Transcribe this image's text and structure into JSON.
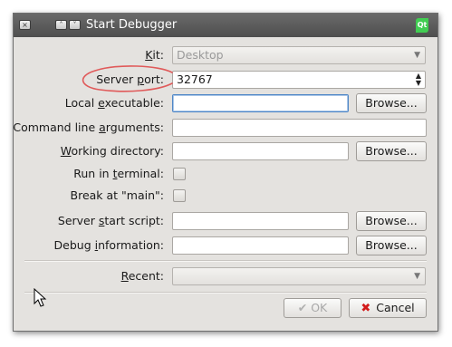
{
  "window": {
    "title": "Start Debugger",
    "close_glyph": "×",
    "minimize_glyph": "˄",
    "maximize_glyph": "˅",
    "app_icon_text": "Qt"
  },
  "form": {
    "kit": {
      "label_pre": "",
      "label_ul": "K",
      "label_post": "it:",
      "value": "Desktop"
    },
    "server_port": {
      "label_pre": "Server ",
      "label_ul": "p",
      "label_post": "ort:",
      "value": "32767"
    },
    "local_executable": {
      "label_pre": "Local ",
      "label_ul": "e",
      "label_post": "xecutable:",
      "value": "",
      "browse": "Browse..."
    },
    "command_line_arguments": {
      "label_pre": "Command line ",
      "label_ul": "a",
      "label_post": "rguments:",
      "value": ""
    },
    "working_directory": {
      "label_pre": "",
      "label_ul": "W",
      "label_post": "orking directory:",
      "value": "",
      "browse": "Browse..."
    },
    "run_in_terminal": {
      "label_pre": "Run in ",
      "label_ul": "t",
      "label_post": "erminal:",
      "checked": false
    },
    "break_at_main": {
      "label_pre": "Break at \"main\":",
      "label_ul": "",
      "label_post": "",
      "checked": false
    },
    "server_start_script": {
      "label_pre": "Server ",
      "label_ul": "s",
      "label_post": "tart script:",
      "value": "",
      "browse": "Browse..."
    },
    "debug_information": {
      "label_pre": "Debug ",
      "label_ul": "i",
      "label_post": "nformation:",
      "value": "",
      "browse": "Browse..."
    },
    "recent": {
      "label_pre": "",
      "label_ul": "R",
      "label_post": "ecent:",
      "value": ""
    }
  },
  "buttons": {
    "ok": "OK",
    "cancel": "Cancel"
  },
  "colors": {
    "titlebar": "#5a5a5a",
    "dialog_bg": "#e4e2df",
    "annotation": "#e05a5a",
    "cancel_x": "#d21a1a"
  }
}
